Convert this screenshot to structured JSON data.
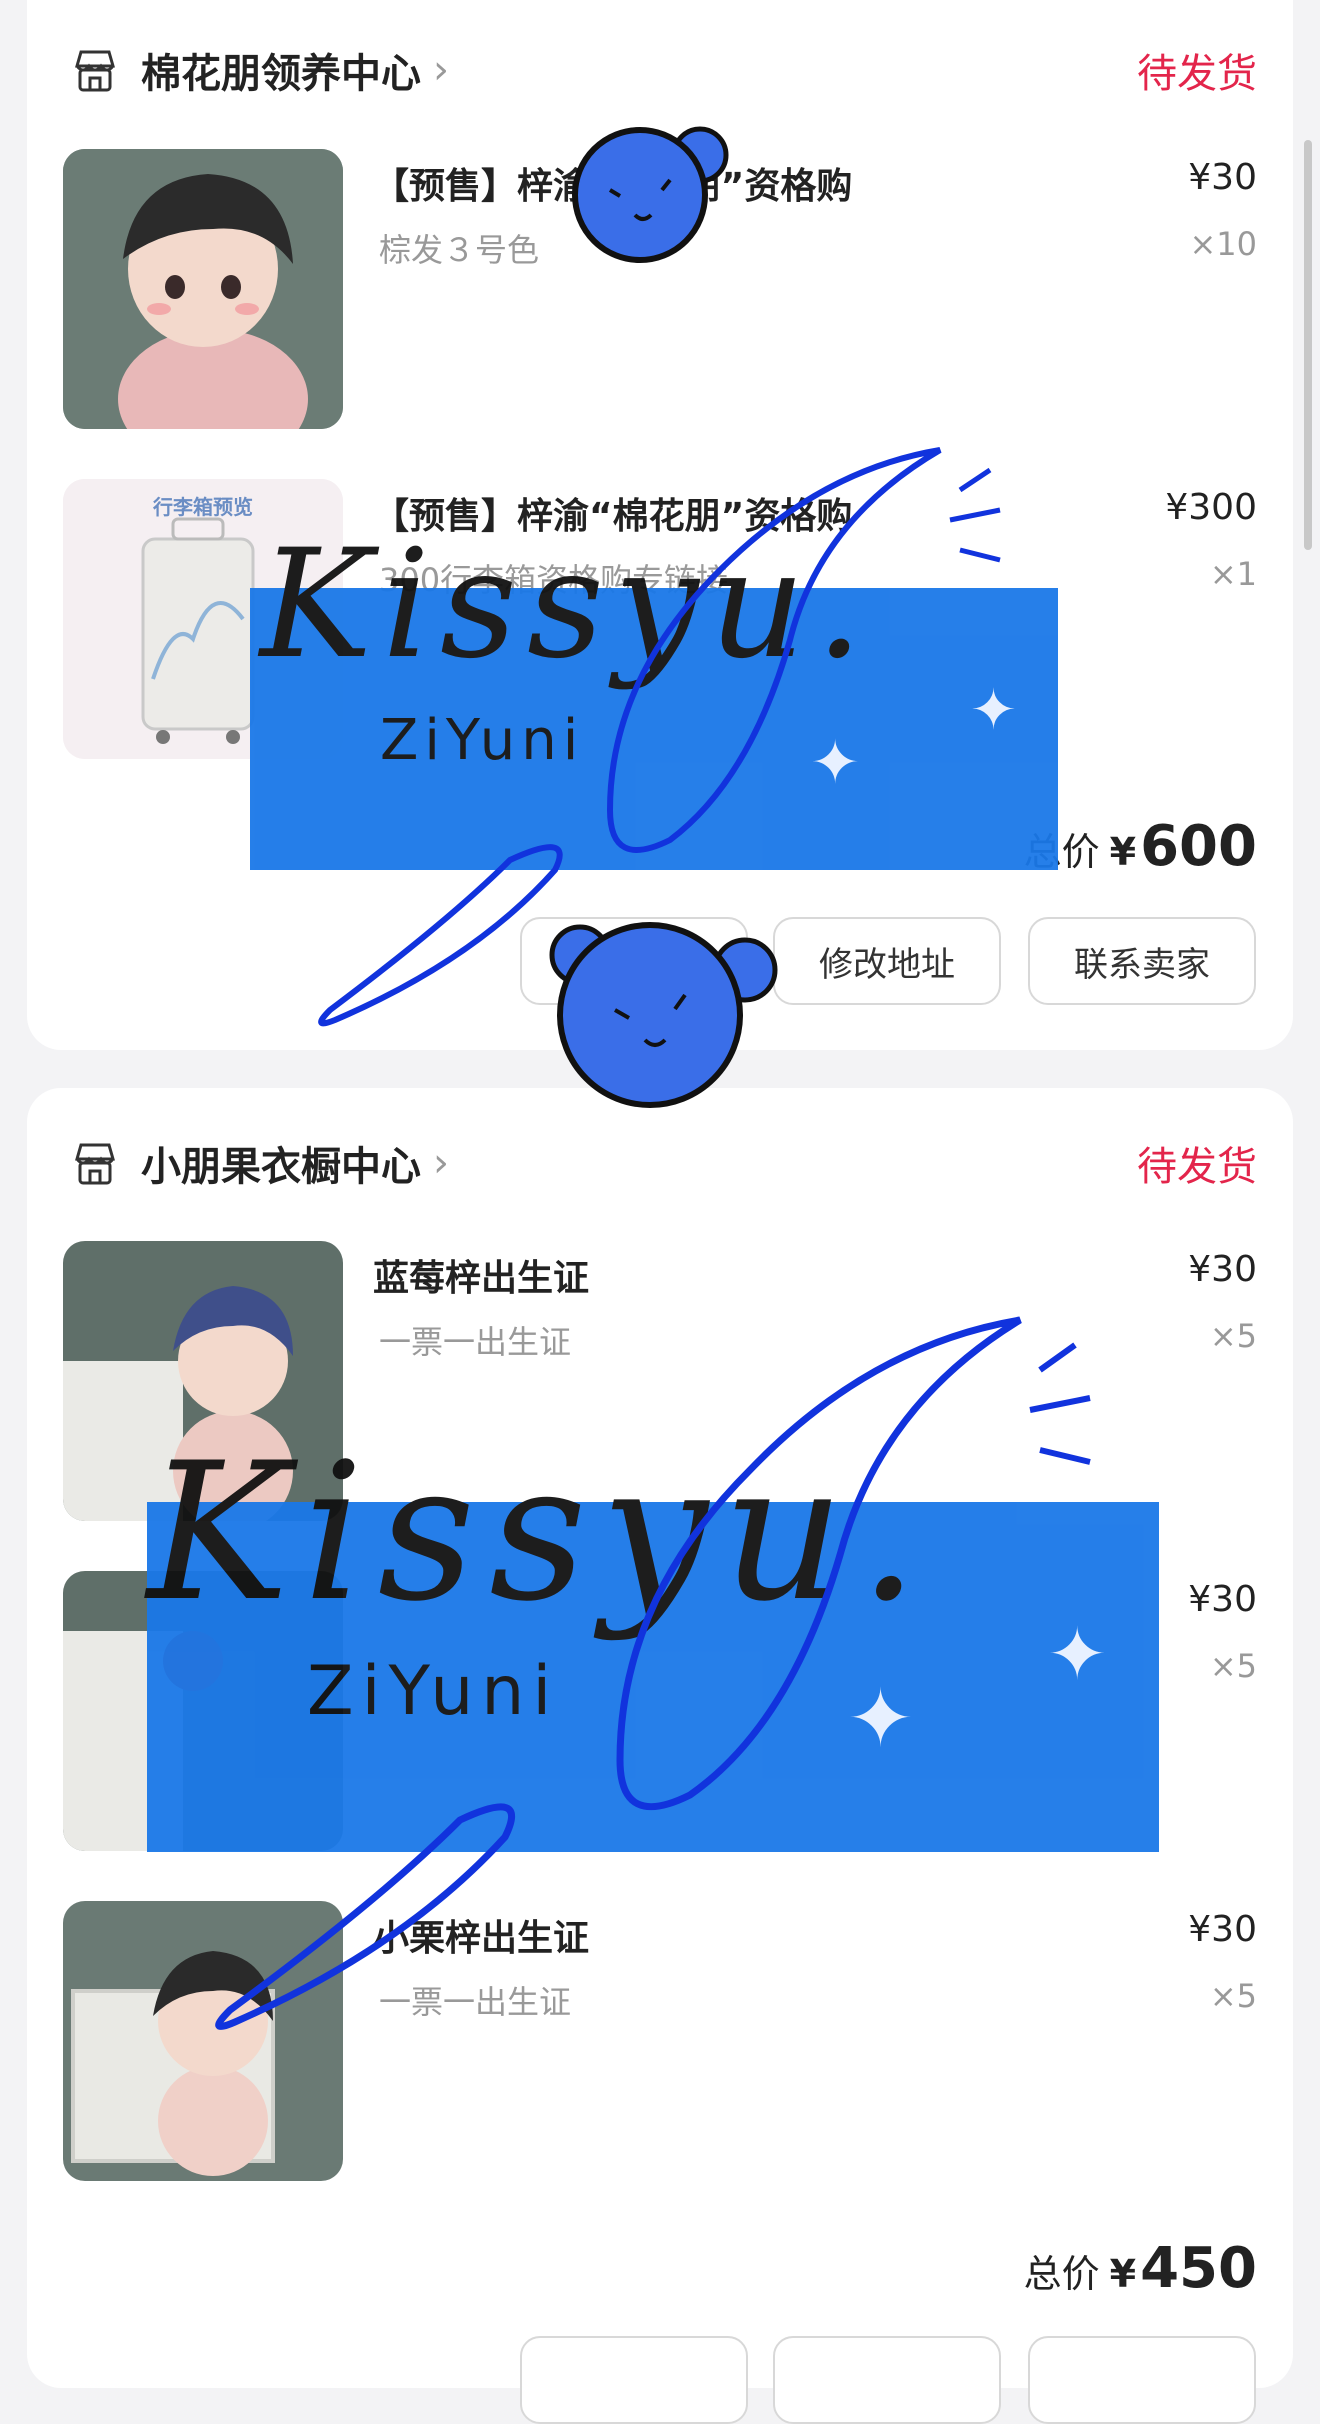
{
  "order1": {
    "shop_name": "棉花朋领养中心",
    "status": "待发货",
    "items": [
      {
        "title": "【预售】梓渝“棉花朋”资格购",
        "spec": "棕发３号色",
        "price": "¥30",
        "qty": "×10"
      },
      {
        "title": "【预售】梓渝“棉花朋”资格购",
        "spec": "300行李箱资格购专链接",
        "price": "¥300",
        "qty": "×1",
        "thumb_caption": "行李箱预览"
      }
    ],
    "total_label": "总价",
    "total_currency": "¥",
    "total_value": "600",
    "buttons": [
      "修改地址",
      "联系卖家"
    ]
  },
  "order2": {
    "shop_name": "小朋果衣橱中心",
    "status": "待发货",
    "items": [
      {
        "title": "蓝莓梓出生证",
        "spec": "一票一出生证",
        "price": "¥30",
        "qty": "×5"
      },
      {
        "title": "",
        "spec": "",
        "price": "¥30",
        "qty": "×5"
      },
      {
        "title": "小栗梓出生证",
        "spec": "一票一出生证",
        "price": "¥30",
        "qty": "×5"
      }
    ],
    "total_label": "总价",
    "total_currency": "¥",
    "total_value": "450"
  },
  "watermark": {
    "signature": "Kissyu.",
    "name": "ZiYuni"
  },
  "colors": {
    "status": "#e3254b",
    "watermark_blue": "#1a73e8",
    "page_bg": "#f3f3f5"
  },
  "icons": [
    "shop-icon",
    "chevron-right-icon"
  ]
}
